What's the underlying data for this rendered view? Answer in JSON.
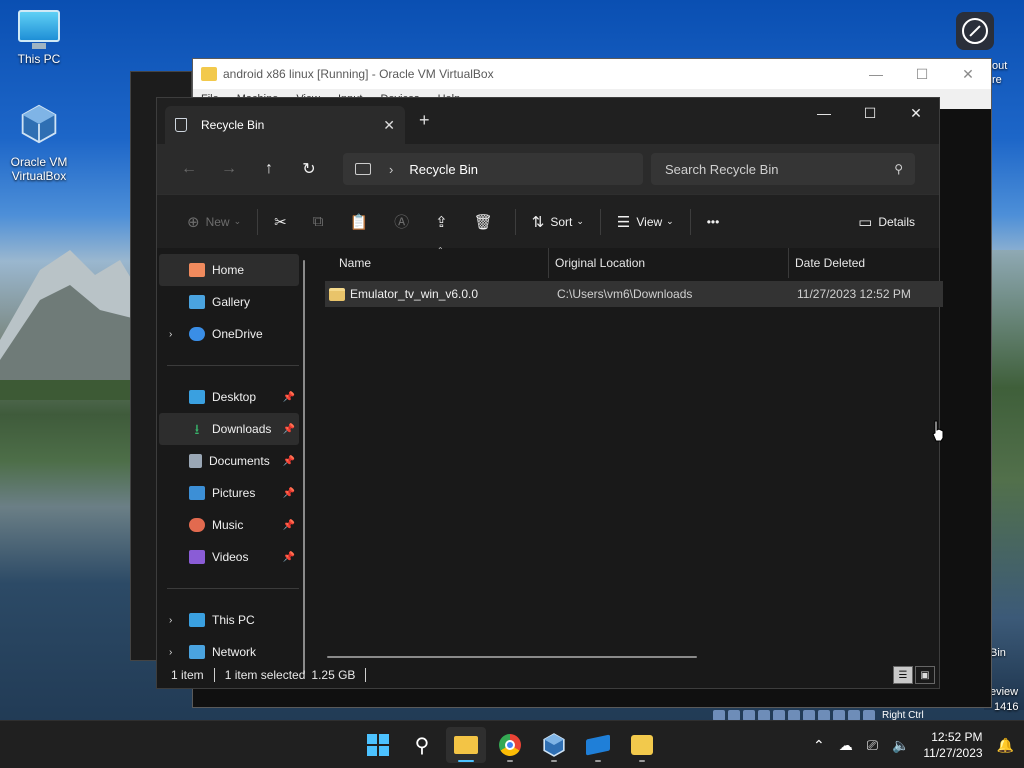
{
  "desktop": {
    "icons": [
      {
        "label": "This PC"
      },
      {
        "label": "Oracle VM VirtualBox"
      }
    ],
    "edge_texts": [
      "out",
      "re",
      "Bin",
      "eview",
      "1416"
    ]
  },
  "vbox_window": {
    "title": "android x86 linux [Running] - Oracle VM VirtualBox",
    "menu": [
      "File",
      "Machine",
      "View",
      "Input",
      "Devices",
      "Help"
    ],
    "host_key_label": "Right Ctrl"
  },
  "explorer": {
    "tab_title": "Recycle Bin",
    "address": {
      "location": "Recycle Bin"
    },
    "search": {
      "placeholder": "Search Recycle Bin"
    },
    "toolbar": {
      "new_label": "New",
      "sort_label": "Sort",
      "view_label": "View",
      "more_label": "•••",
      "details_label": "Details"
    },
    "sidebar": {
      "top": [
        {
          "label": "Home",
          "icon": "home-icon",
          "color": "#f08a5d"
        },
        {
          "label": "Gallery",
          "icon": "gallery-icon",
          "color": "#4aa3df"
        },
        {
          "label": "OneDrive",
          "icon": "onedrive-icon",
          "color": "#3a8ee6"
        }
      ],
      "quick_access": [
        {
          "label": "Desktop",
          "icon": "desktop-icon",
          "color": "#3aa0e0"
        },
        {
          "label": "Downloads",
          "icon": "downloads-icon",
          "color": "#38b36b"
        },
        {
          "label": "Documents",
          "icon": "documents-icon",
          "color": "#9aa7b5"
        },
        {
          "label": "Pictures",
          "icon": "pictures-icon",
          "color": "#3c8fd6"
        },
        {
          "label": "Music",
          "icon": "music-icon",
          "color": "#e26a4f"
        },
        {
          "label": "Videos",
          "icon": "videos-icon",
          "color": "#8a5cd6"
        }
      ],
      "bottom": [
        {
          "label": "This PC",
          "icon": "this-pc-icon",
          "color": "#3aa0e0"
        },
        {
          "label": "Network",
          "icon": "network-icon",
          "color": "#4aa3df"
        }
      ]
    },
    "columns": [
      "Name",
      "Original Location",
      "Date Deleted"
    ],
    "rows": [
      {
        "name": "Emulator_tv_win_v6.0.0",
        "location": "C:\\Users\\vm6\\Downloads",
        "date": "11/27/2023 12:52 PM"
      }
    ],
    "status": {
      "count": "1 item",
      "selected": "1 item selected",
      "size": "1.25 GB"
    }
  },
  "taskbar": {
    "time": "12:52 PM",
    "date": "11/27/2023"
  }
}
